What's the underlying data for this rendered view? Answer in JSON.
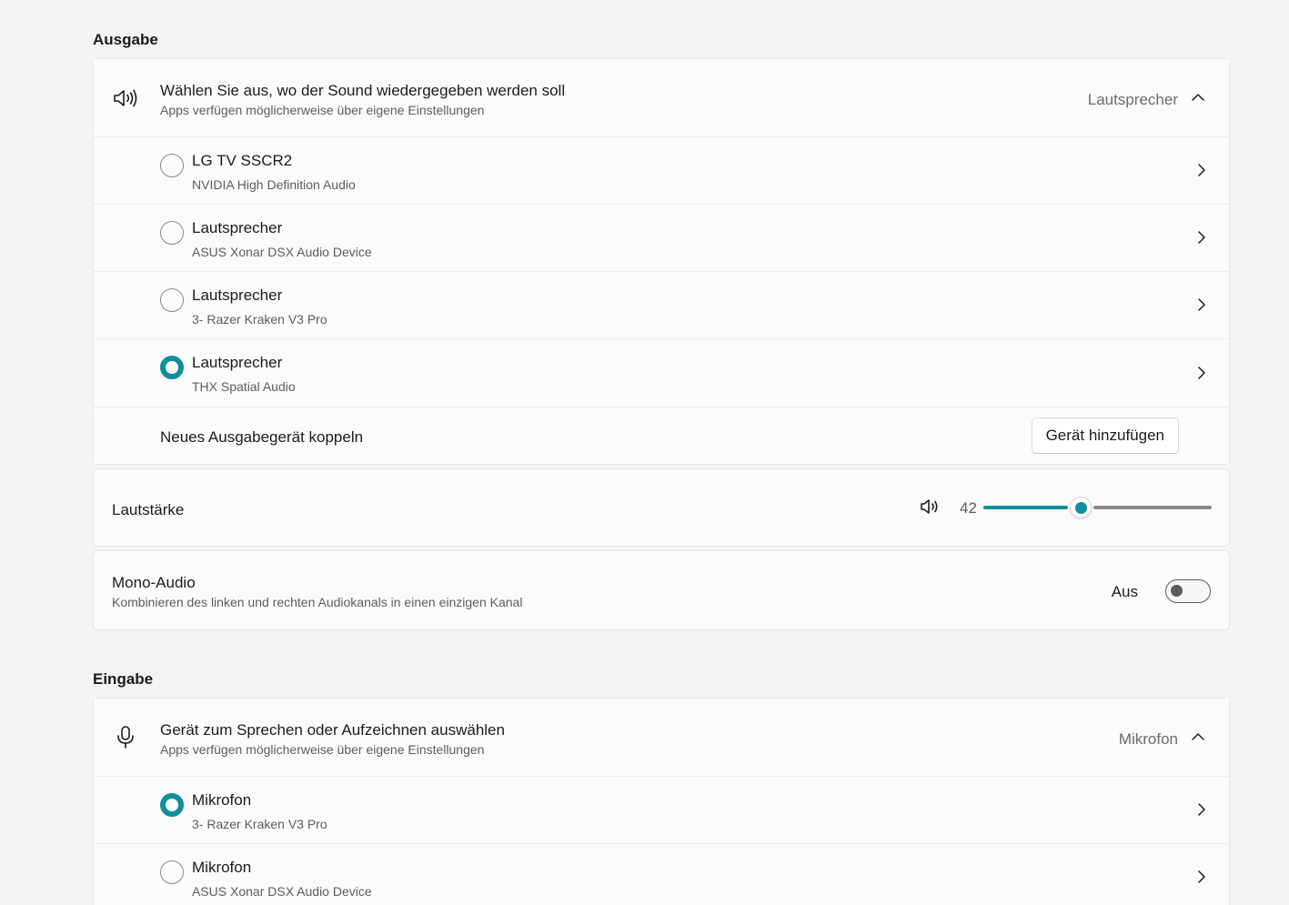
{
  "colors": {
    "accent": "#0f8f9a",
    "background": "#f3f3f3",
    "card": "#fbfbfb"
  },
  "output": {
    "section_title": "Ausgabe",
    "selector": {
      "icon": "speaker-icon",
      "title": "Wählen Sie aus, wo der Sound wiedergegeben werden soll",
      "subtitle": "Apps verfügen möglicherweise über eigene Einstellungen",
      "value": "Lautsprecher",
      "expanded": true
    },
    "devices": [
      {
        "name": "LG TV SSCR2",
        "sub": "NVIDIA High Definition Audio",
        "selected": false
      },
      {
        "name": "Lautsprecher",
        "sub": "ASUS Xonar DSX Audio Device",
        "selected": false
      },
      {
        "name": "Lautsprecher",
        "sub": "3- Razer Kraken V3 Pro",
        "selected": false
      },
      {
        "name": "Lautsprecher",
        "sub": "THX Spatial Audio",
        "selected": true
      }
    ],
    "pair": {
      "label": "Neues Ausgabegerät koppeln",
      "button": "Gerät hinzufügen"
    }
  },
  "volume": {
    "label": "Lautstärke",
    "value": "42",
    "level": 42,
    "icon": "speaker-icon"
  },
  "mono": {
    "title": "Mono-Audio",
    "subtitle": "Kombinieren des linken und rechten Audiokanals in einen einzigen Kanal",
    "state_label": "Aus",
    "on": false
  },
  "input": {
    "section_title": "Eingabe",
    "selector": {
      "icon": "microphone-icon",
      "title": "Gerät zum Sprechen oder Aufzeichnen auswählen",
      "subtitle": "Apps verfügen möglicherweise über eigene Einstellungen",
      "value": "Mikrofon",
      "expanded": true
    },
    "devices": [
      {
        "name": "Mikrofon",
        "sub": "3- Razer Kraken V3 Pro",
        "selected": true
      },
      {
        "name": "Mikrofon",
        "sub": "ASUS Xonar DSX Audio Device",
        "selected": false
      }
    ]
  }
}
